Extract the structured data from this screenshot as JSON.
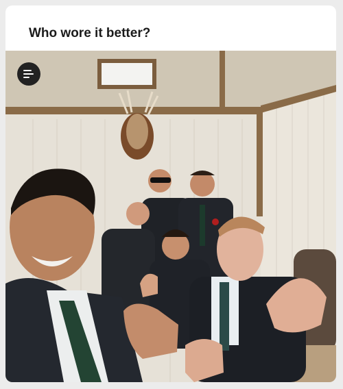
{
  "post": {
    "title": "Who wore it better?"
  },
  "photo": {
    "subject": "group-selfie"
  },
  "icons": {
    "menu": "menu-lines-icon"
  },
  "colors": {
    "card_bg": "#ffffff",
    "page_bg": "#ececec",
    "title_text": "#1b1b1b",
    "menu_button_bg": "#222222"
  }
}
